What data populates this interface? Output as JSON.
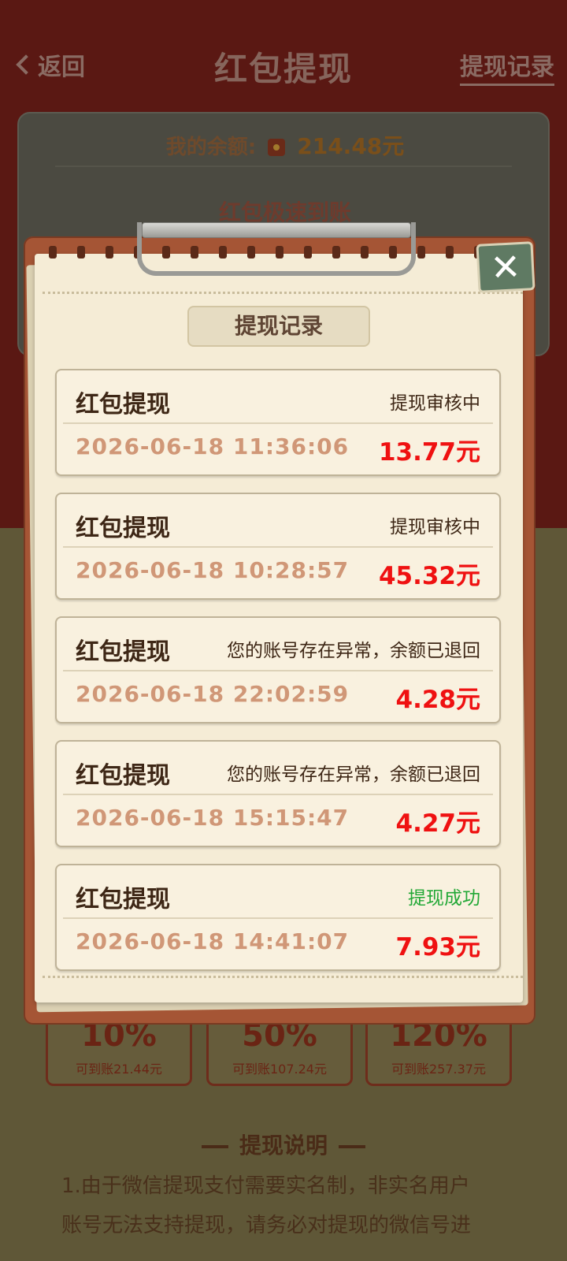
{
  "nav": {
    "back_label": "返回",
    "title": "红包提现",
    "record_link": "提现记录"
  },
  "balance": {
    "label": "我的余额:",
    "amount": "214.48元",
    "speed_label": "红包极速到账"
  },
  "percent_options": [
    {
      "percent": "10%",
      "sub": "可到账21.44元"
    },
    {
      "percent": "50%",
      "sub": "可到账107.24元"
    },
    {
      "percent": "120%",
      "sub": "可到账257.37元"
    }
  ],
  "explain": {
    "title": "提现说明",
    "lines": [
      "1.由于微信提现支付需要实名制，非实名用户",
      "账号无法支持提现，请务必对提现的微信号进"
    ]
  },
  "modal": {
    "title": "提现记录",
    "close_symbol": "✕",
    "records": [
      {
        "type": "红包提现",
        "status": "提现审核中",
        "time": "2026-06-18 11:36:06",
        "amount": "13.77元"
      },
      {
        "type": "红包提现",
        "status": "提现审核中",
        "time": "2026-06-18 10:28:57",
        "amount": "45.32元"
      },
      {
        "type": "红包提现",
        "status": "您的账号存在异常，余额已退回",
        "time": "2026-06-18 22:02:59",
        "amount": "4.28元"
      },
      {
        "type": "红包提现",
        "status": "您的账号存在异常，余额已退回",
        "time": "2026-06-18 15:15:47",
        "amount": "4.27元"
      },
      {
        "type": "红包提现",
        "status": "提现成功",
        "time": "2026-06-18 14:41:07",
        "amount": "7.93元"
      }
    ]
  },
  "colors": {
    "amount_red": "#ef1111",
    "success_green": "#22a836",
    "board_brown": "#a55535",
    "paper": "#f5ecd6"
  }
}
